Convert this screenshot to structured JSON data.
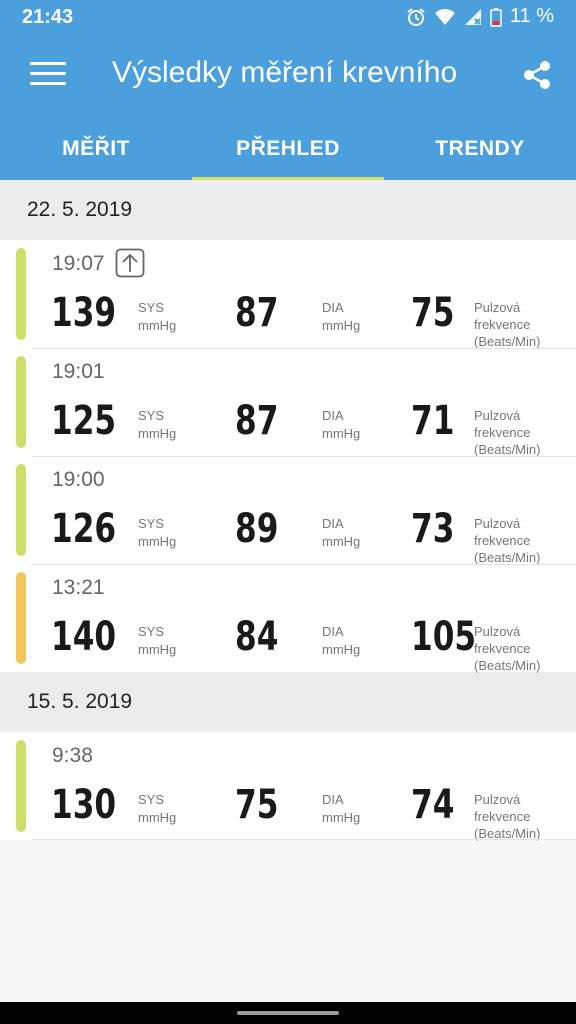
{
  "status_bar": {
    "time": "21:43",
    "battery": "11 %",
    "icons": [
      "alarm-icon",
      "wifi-icon",
      "signal-icon",
      "battery-icon"
    ]
  },
  "app_bar": {
    "title": "Výsledky měření krevního",
    "menu_icon": "menu-icon",
    "share_icon": "share-icon"
  },
  "tabs": [
    {
      "label": "MĚŘIT",
      "active": false
    },
    {
      "label": "PŘEHLED",
      "active": true
    },
    {
      "label": "TRENDY",
      "active": false
    }
  ],
  "units": {
    "sys": "SYS",
    "dia": "DIA",
    "mmhg": "mmHg",
    "pulse_line1": "Pulzová",
    "pulse_line2": "frekvence",
    "pulse_line3": "(Beats/Min)"
  },
  "colors": {
    "primary": "#4a9fdc",
    "tab_indicator": "#cfe16a",
    "normal": "#cddf6b",
    "elevated": "#f2c55a"
  },
  "groups": [
    {
      "date": "22. 5. 2019",
      "entries": [
        {
          "time": "19:07",
          "sys": "139",
          "dia": "87",
          "pulse": "75",
          "status": "normal",
          "uploaded_icon": true
        },
        {
          "time": "19:01",
          "sys": "125",
          "dia": "87",
          "pulse": "71",
          "status": "normal",
          "uploaded_icon": false
        },
        {
          "time": "19:00",
          "sys": "126",
          "dia": "89",
          "pulse": "73",
          "status": "normal",
          "uploaded_icon": false
        },
        {
          "time": "13:21",
          "sys": "140",
          "dia": "84",
          "pulse": "105",
          "status": "elevated",
          "uploaded_icon": false
        }
      ]
    },
    {
      "date": "15. 5. 2019",
      "entries": [
        {
          "time": "9:38",
          "sys": "130",
          "dia": "75",
          "pulse": "74",
          "status": "normal",
          "uploaded_icon": false
        }
      ]
    }
  ]
}
